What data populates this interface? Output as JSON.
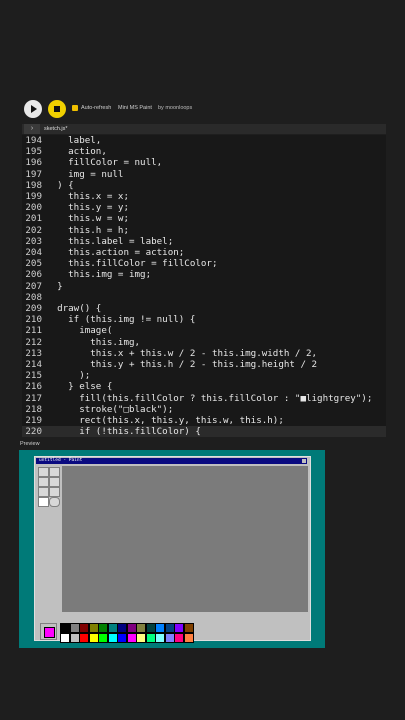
{
  "toolbar": {
    "autorefresh_label": "Auto-refresh",
    "sketch_name": "Mini MS Paint",
    "byline": "by moonloops"
  },
  "tab": {
    "filename": "sketch.js*"
  },
  "code_lines": [
    {
      "n": "194",
      "t": "    label,"
    },
    {
      "n": "195",
      "t": "    action,"
    },
    {
      "n": "196",
      "t": "    fillColor = null,"
    },
    {
      "n": "197",
      "t": "    img = null"
    },
    {
      "n": "198",
      "t": "  ) {"
    },
    {
      "n": "199",
      "t": "    this.x = x;"
    },
    {
      "n": "200",
      "t": "    this.y = y;"
    },
    {
      "n": "201",
      "t": "    this.w = w;"
    },
    {
      "n": "202",
      "t": "    this.h = h;"
    },
    {
      "n": "203",
      "t": "    this.label = label;"
    },
    {
      "n": "204",
      "t": "    this.action = action;"
    },
    {
      "n": "205",
      "t": "    this.fillColor = fillColor;"
    },
    {
      "n": "206",
      "t": "    this.img = img;"
    },
    {
      "n": "207",
      "t": "  }"
    },
    {
      "n": "208",
      "t": ""
    },
    {
      "n": "209",
      "t": "  draw() {"
    },
    {
      "n": "210",
      "t": "    if (this.img != null) {"
    },
    {
      "n": "211",
      "t": "      image("
    },
    {
      "n": "212",
      "t": "        this.img,"
    },
    {
      "n": "213",
      "t": "        this.x + this.w / 2 - this.img.width / 2,"
    },
    {
      "n": "214",
      "t": "        this.y + this.h / 2 - this.img.height / 2"
    },
    {
      "n": "215",
      "t": "      );"
    },
    {
      "n": "216",
      "t": "    } else {"
    },
    {
      "n": "217",
      "t": "      fill(this.fillColor ? this.fillColor : \"■lightgrey\");"
    },
    {
      "n": "218",
      "t": "      stroke(\"□black\");"
    },
    {
      "n": "219",
      "t": "      rect(this.x, this.y, this.w, this.h);"
    },
    {
      "n": "220",
      "t": "      if (!this.fillColor) {"
    }
  ],
  "preview": {
    "label": "Preview",
    "window_title": "untitled - Paint"
  },
  "current_color": "#ff00ff",
  "palette_colors": [
    [
      "#000000",
      "#808080",
      "#800000",
      "#808000",
      "#008000",
      "#008080",
      "#000080",
      "#800080",
      "#808040",
      "#004040",
      "#0080ff",
      "#004080",
      "#8000ff",
      "#804000"
    ],
    [
      "#ffffff",
      "#c0c0c0",
      "#ff0000",
      "#ffff00",
      "#00ff00",
      "#00ffff",
      "#0000ff",
      "#ff00ff",
      "#ffff80",
      "#00ff80",
      "#80ffff",
      "#8080ff",
      "#ff0080",
      "#ff8040"
    ]
  ]
}
